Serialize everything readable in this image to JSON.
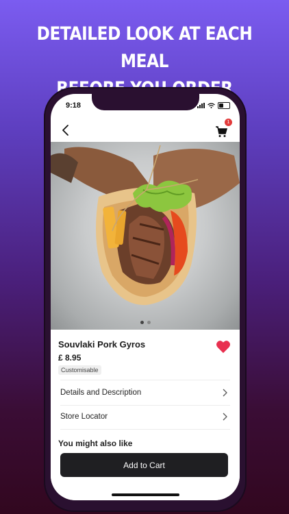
{
  "headline": {
    "line1": "DETAILED LOOK AT EACH MEAL",
    "line2": "BEFORE YOU ORDER"
  },
  "status": {
    "time": "9:18"
  },
  "nav": {
    "back_icon": "chevron-left-icon",
    "cart_icon": "cart-icon",
    "cart_count": "1"
  },
  "hero": {
    "image": "gyros-wrap-photo",
    "slides": 2,
    "active_slide": 1
  },
  "product": {
    "name": "Souvlaki Pork Gyros",
    "price": "£ 8.95",
    "tag": "Customisable",
    "favorite": true
  },
  "rows": [
    {
      "label": "Details and Description"
    },
    {
      "label": "Store Locator"
    }
  ],
  "section": {
    "also_like": "You might also like"
  },
  "cta": {
    "label": "Add to Cart"
  },
  "colors": {
    "accent_red": "#e8304f",
    "button": "#1f1f22",
    "cart_badge": "#e23b3b"
  }
}
